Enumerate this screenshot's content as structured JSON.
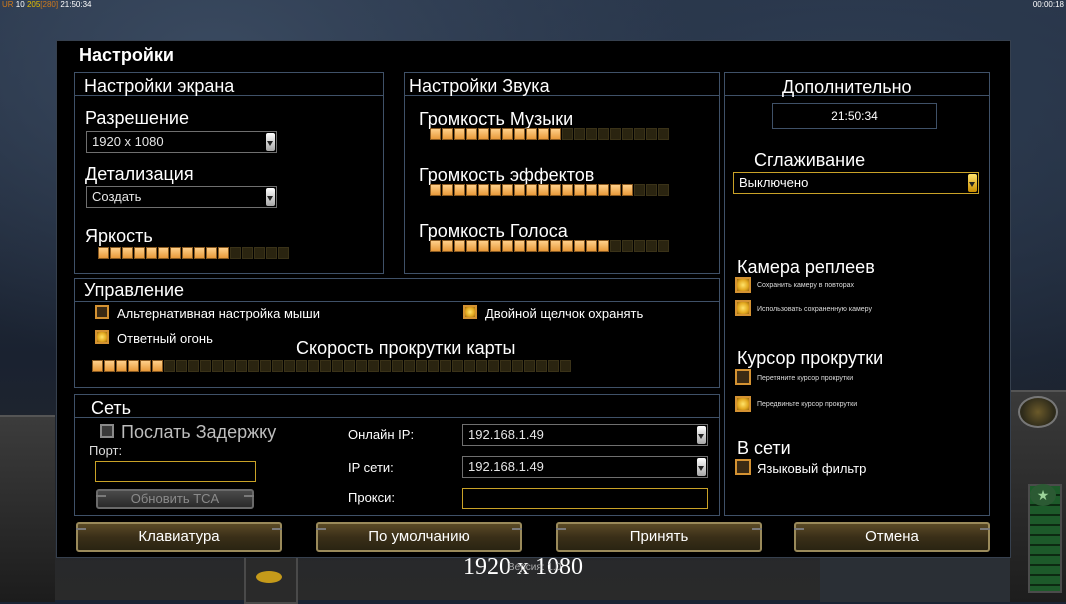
{
  "topbar": {
    "left_prefix": "UR",
    "left_a": "10",
    "left_b": "205",
    "left_c": "[280]",
    "left_time": "21:50:34",
    "right_time": "00:00:18"
  },
  "dialog": {
    "title": "Настройки"
  },
  "screen": {
    "section_label": "Настройки экрана",
    "resolution_label": "Разрешение",
    "resolution_value": "1920 x 1080",
    "detail_label": "Детализация",
    "detail_value": "Создать",
    "brightness_label": "Яркость",
    "brightness_level": 11,
    "brightness_max": 16
  },
  "sound": {
    "section_label": "Настройки Звука",
    "music_label": "Громкость Музыки",
    "music_level": 11,
    "music_max": 20,
    "effects_label": "Громкость эффектов",
    "effects_level": 17,
    "effects_max": 20,
    "voice_label": "Громкость Голоса",
    "voice_level": 15,
    "voice_max": 20
  },
  "controls": {
    "section_label": "Управление",
    "alt_mouse_label": "Альтернативная настройка мыши",
    "alt_mouse_checked": false,
    "double_click_label": "Двойной щелчок охранять",
    "double_click_checked": true,
    "return_fire_label": "Ответный огонь",
    "return_fire_checked": true,
    "scroll_speed_label": "Скорость прокрутки карты",
    "scroll_speed_level": 6,
    "scroll_speed_max": 40
  },
  "network": {
    "section_label": "Сеть",
    "send_delay_label": "Послать Задержку",
    "port_label": "Порт:",
    "port_value": "",
    "update_tca_label": "Обновить TCA",
    "online_ip_label": "Онлайн IP:",
    "online_ip_value": "192.168.1.49",
    "lan_ip_label": "IP сети:",
    "lan_ip_value": "192.168.1.49",
    "proxy_label": "Прокси:",
    "proxy_value": ""
  },
  "extra": {
    "section_label": "Дополнительно",
    "clock": "21:50:34",
    "antialias_label": "Сглаживание",
    "antialias_value": "Выключено",
    "replay_camera_label": "Камера реплеев",
    "save_camera_label": "Сохранить камеру в повторах",
    "use_saved_camera_label": "Использовать сохраненную камеру",
    "scroll_cursor_label": "Курсор прокрутки",
    "drag_cursor_label": "Перетяните курсор прокрутки",
    "move_cursor_label": "Передвиньте курсор прокрутки",
    "online_label": "В сети",
    "language_filter_label": "Языковый фильтр"
  },
  "buttons": {
    "keyboard": "Клавиатура",
    "defaults": "По умолчанию",
    "accept": "Принять",
    "cancel": "Отмена"
  },
  "footer": {
    "resolution_text": "1920 x 1080",
    "version_text": "Версия: 1.0"
  }
}
